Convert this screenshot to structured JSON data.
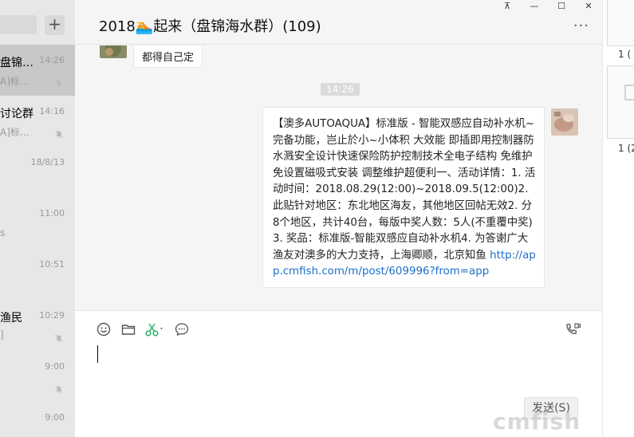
{
  "chat_list": {
    "add_label": "+",
    "items": [
      {
        "name": "盘锦…",
        "preview": "A]标…",
        "time": "14:26",
        "muted": true,
        "active": true
      },
      {
        "name": "讨论群",
        "preview": "A]标…",
        "time": "14:16",
        "muted": true,
        "active": false
      },
      {
        "name": "",
        "preview": "",
        "time": "18/8/13",
        "muted": false,
        "active": false
      },
      {
        "name": "",
        "preview": "s",
        "time": "11:00",
        "muted": false,
        "active": false
      },
      {
        "name": "",
        "preview": "",
        "time": "10:51",
        "muted": false,
        "active": false
      },
      {
        "name": "渔民",
        "preview": "]",
        "time": "10:29",
        "muted": true,
        "active": false
      },
      {
        "name": "",
        "preview": "",
        "time": "9:00",
        "muted": true,
        "active": false
      },
      {
        "name": "",
        "preview": "",
        "time": "9:00",
        "muted": false,
        "active": false
      }
    ]
  },
  "header": {
    "title": "2018🏊起来（盘锦海水群）(109)",
    "more_label": "···",
    "window_controls": {
      "pin": "⊼",
      "minimize": "—",
      "maximize": "☐",
      "close": "✕"
    }
  },
  "messages": {
    "prev_text": "都得自己定",
    "time_divider": "14:26",
    "main_text": "【澳多AUTOAQUA】标准版 - 智能双感应自动补水机~完备功能，岂止於小~小体积 大效能 即插即用控制器防水溅安全设计快速保险防护控制技术全电子结构 免维护 免设置磁吸式安装 调整维护超便利一、活动详情：1. 活动时间：2018.08.29(12:00)~2018.09.5(12:00)2. 此贴针对地区：东北地区海友，其他地区回帖无效2. 分8个地区，共计40台，每版中奖人数：5人(不重覆中奖)3. 奖品：标准版-智能双感应自动补水机4. 为答谢广大渔友对澳多的大力支持，上海卿顺，北京知鱼 ",
    "link_text": "http://app.cmfish.com/m/post/609996?from=app"
  },
  "input": {
    "send_label": "发送(S)"
  },
  "right_panel": {
    "labels": [
      "1 (",
      "1 (2"
    ]
  },
  "watermark": "cmfish.com",
  "colors": {
    "link": "#1d6fc9",
    "bubble": "#ffffff",
    "list_bg": "#e8e7e7",
    "active_item": "#c9c8c6",
    "scissors": "#2aae67"
  }
}
